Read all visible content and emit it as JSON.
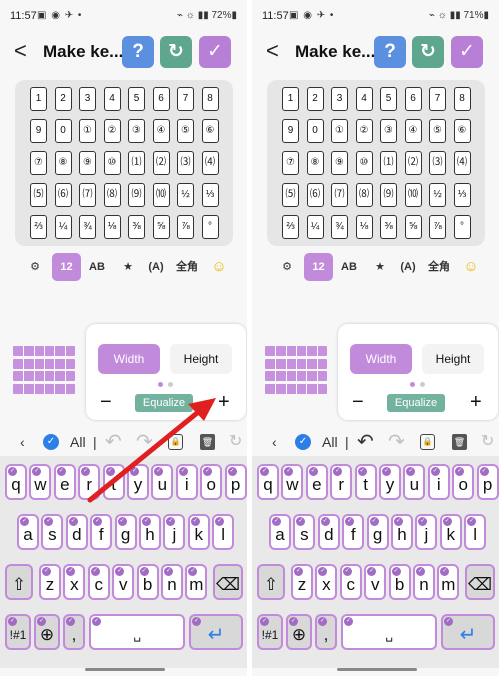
{
  "left": {
    "status": {
      "time": "11:57",
      "icons": "▣ ◉ ✈ •",
      "right": "⌁ ☼ ▮▮ 72%▮"
    },
    "title": "Make ke...",
    "tabs_selected": 1,
    "row_widths": [
      62,
      62,
      62,
      62
    ],
    "edit_icons_faded": [
      true,
      true,
      false,
      false
    ],
    "edit_icon_labels": [
      "▢",
      "🗑"
    ]
  },
  "right": {
    "status": {
      "time": "11:57",
      "icons": "▣ ◉ ✈ •",
      "right": "⌁ ☼ ▮▮ 71%▮"
    },
    "title": "Make ke...",
    "tabs_selected": 1,
    "row_widths": [
      62,
      62,
      62,
      62
    ],
    "edit_icons_faded": [
      false,
      true,
      false,
      false
    ],
    "edit_icon_labels": [
      "⟳",
      "🗑"
    ]
  },
  "grid_cells": [
    [
      "1",
      "2",
      "3",
      "4",
      "5",
      "6",
      "7",
      "8"
    ],
    [
      "9",
      "0",
      "①",
      "②",
      "③",
      "④",
      "⑤",
      "⑥"
    ],
    [
      "⑦",
      "⑧",
      "⑨",
      "⑩",
      "⑴",
      "⑵",
      "⑶",
      "⑷"
    ],
    [
      "⑸",
      "⑹",
      "⑺",
      "⑻",
      "⑼",
      "⑽",
      "½",
      "⅓"
    ],
    [
      "⅔",
      "¼",
      "¾",
      "⅛",
      "⅜",
      "⅝",
      "⅞",
      "°"
    ]
  ],
  "tabs": [
    "⚙",
    "12",
    "AB",
    "★",
    "(A)",
    "全角",
    "☺"
  ],
  "panel": {
    "width_label": "Width",
    "height_label": "Height",
    "equalize_label": "Equalize",
    "minus": "−",
    "plus": "+"
  },
  "edit_bar": {
    "back": "‹",
    "check": "✓",
    "all_label": "All",
    "divider": "|",
    "undo": "↶",
    "redo": "↷",
    "lock": "🔒",
    "trash": "🗑",
    "rotate": "↻"
  },
  "keyboard": {
    "row1": [
      "q",
      "w",
      "e",
      "r",
      "t",
      "y",
      "u",
      "i",
      "o",
      "p"
    ],
    "row2": [
      "a",
      "s",
      "d",
      "f",
      "g",
      "h",
      "j",
      "k",
      "l"
    ],
    "row3": [
      "z",
      "x",
      "c",
      "v",
      "b",
      "n",
      "m"
    ],
    "shift": "⇧",
    "backspace": "⌫",
    "sym": "!#1",
    "globe": "⊕",
    "comma": ",",
    "space": "␣",
    "enter": "↵",
    "check_mark": "✓"
  },
  "colors": {
    "accent": "#c28adb",
    "help": "#5b8fe0",
    "reset": "#5ea68e",
    "ok": "#b77fd6",
    "equalize": "#73b29f",
    "arrow": "#e02020"
  }
}
